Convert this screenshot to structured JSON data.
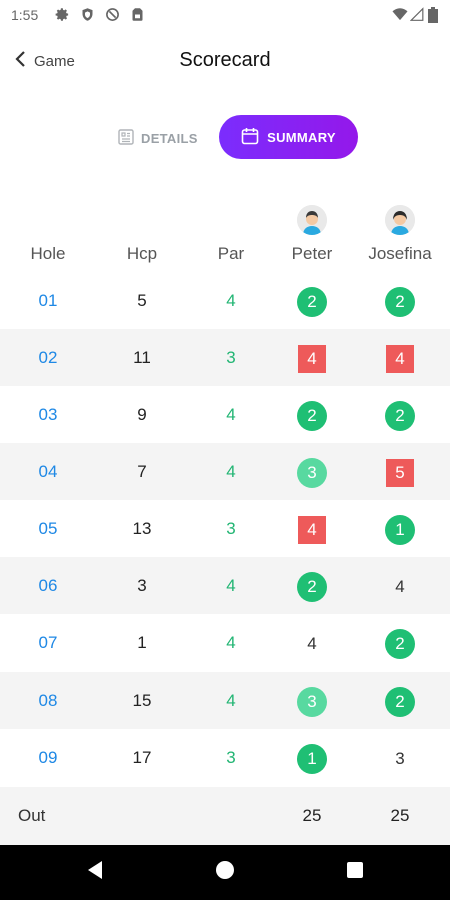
{
  "status_bar": {
    "time": "1:55",
    "left_icons": [
      "gear-icon",
      "shield-icon",
      "do-not-disturb-icon",
      "sim-card-icon"
    ],
    "right_icons": [
      "wifi-icon",
      "cell-signal-icon",
      "battery-icon"
    ]
  },
  "header": {
    "back_label": "Game",
    "title": "Scorecard"
  },
  "tabs": {
    "details": "DETAILS",
    "summary": "SUMMARY",
    "active": "summary"
  },
  "table": {
    "columns": [
      "Hole",
      "Hcp",
      "Par",
      "Peter",
      "Josefina"
    ],
    "rows": [
      {
        "hole": "01",
        "hcp": "5",
        "par": "4",
        "peter": {
          "value": "2",
          "style": "circle"
        },
        "josefina": {
          "value": "2",
          "style": "circle"
        }
      },
      {
        "hole": "02",
        "hcp": "11",
        "par": "3",
        "peter": {
          "value": "4",
          "style": "square"
        },
        "josefina": {
          "value": "4",
          "style": "square"
        }
      },
      {
        "hole": "03",
        "hcp": "9",
        "par": "4",
        "peter": {
          "value": "2",
          "style": "circle"
        },
        "josefina": {
          "value": "2",
          "style": "circle"
        }
      },
      {
        "hole": "04",
        "hcp": "7",
        "par": "4",
        "peter": {
          "value": "3",
          "style": "light"
        },
        "josefina": {
          "value": "5",
          "style": "square"
        }
      },
      {
        "hole": "05",
        "hcp": "13",
        "par": "3",
        "peter": {
          "value": "4",
          "style": "square"
        },
        "josefina": {
          "value": "1",
          "style": "circle"
        }
      },
      {
        "hole": "06",
        "hcp": "3",
        "par": "4",
        "peter": {
          "value": "2",
          "style": "circle"
        },
        "josefina": {
          "value": "4",
          "style": "plain"
        }
      },
      {
        "hole": "07",
        "hcp": "1",
        "par": "4",
        "peter": {
          "value": "4",
          "style": "plain"
        },
        "josefina": {
          "value": "2",
          "style": "circle"
        }
      },
      {
        "hole": "08",
        "hcp": "15",
        "par": "4",
        "peter": {
          "value": "3",
          "style": "light"
        },
        "josefina": {
          "value": "2",
          "style": "circle"
        }
      },
      {
        "hole": "09",
        "hcp": "17",
        "par": "3",
        "peter": {
          "value": "1",
          "style": "circle"
        },
        "josefina": {
          "value": "3",
          "style": "plain"
        }
      }
    ],
    "out": {
      "label": "Out",
      "peter": "25",
      "josefina": "25"
    }
  },
  "colors": {
    "accent_start": "#7b2dfd",
    "accent_end": "#9418ea",
    "hole_blue": "#1e88e5",
    "par_green": "#21b573",
    "score_green": "#1fbf74",
    "score_light_green": "#58d9a0",
    "score_red": "#ee5a5a"
  },
  "nav_bar": {
    "buttons": [
      "back-triangle-icon",
      "home-circle-icon",
      "recents-square-icon"
    ]
  }
}
